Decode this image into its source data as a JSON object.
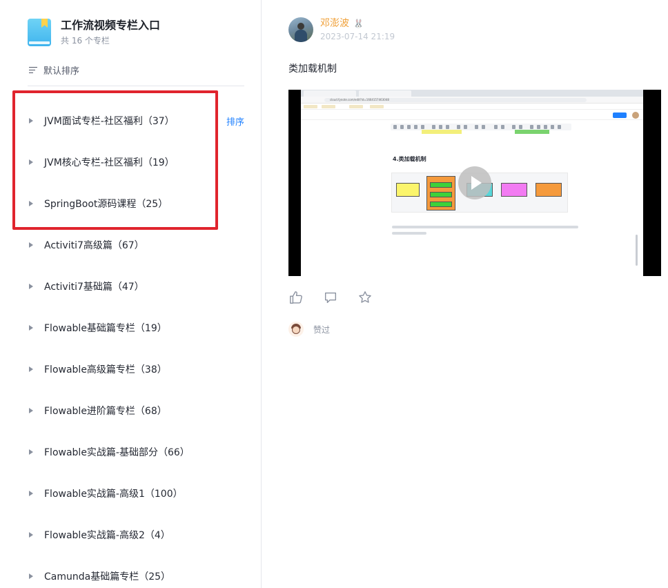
{
  "sidebar": {
    "title": "工作流视频专栏入口",
    "count_text": "共 16 个专栏",
    "sort_label": "默认排序",
    "sort_link": "排序",
    "items": [
      {
        "label": "JVM面试专栏-社区福利（37）"
      },
      {
        "label": "JVM核心专栏-社区福利（19）"
      },
      {
        "label": "SpringBoot源码课程（25）"
      },
      {
        "label": "Activiti7高级篇（67）"
      },
      {
        "label": "Activiti7基础篇（47）"
      },
      {
        "label": "Flowable基础篇专栏（19）"
      },
      {
        "label": "Flowable高级篇专栏（38）"
      },
      {
        "label": "Flowable进阶篇专栏（68）"
      },
      {
        "label": "Flowable实战篇-基础部分（66）"
      },
      {
        "label": "Flowable实战篇-高级1（100）"
      },
      {
        "label": "Flowable实战篇-高级2（4）"
      },
      {
        "label": "Camunda基础篇专栏（25）"
      }
    ]
  },
  "post": {
    "author": "邓澎波",
    "badge_icon": "bunny-icon",
    "time": "2023-07-14 21:19",
    "text": "类加载机制",
    "video": {
      "heading": "4.类加载机制",
      "url": "cloud.fynote.com/edit?id=1664157463048"
    },
    "actions": [
      "like-icon",
      "comment-icon",
      "star-icon"
    ],
    "liked_label": "赞过"
  },
  "colors": {
    "author_name": "#f0a13a",
    "link": "#1e80ff",
    "highlight": "#e0242d",
    "book_icon": "#3fb4ee"
  }
}
